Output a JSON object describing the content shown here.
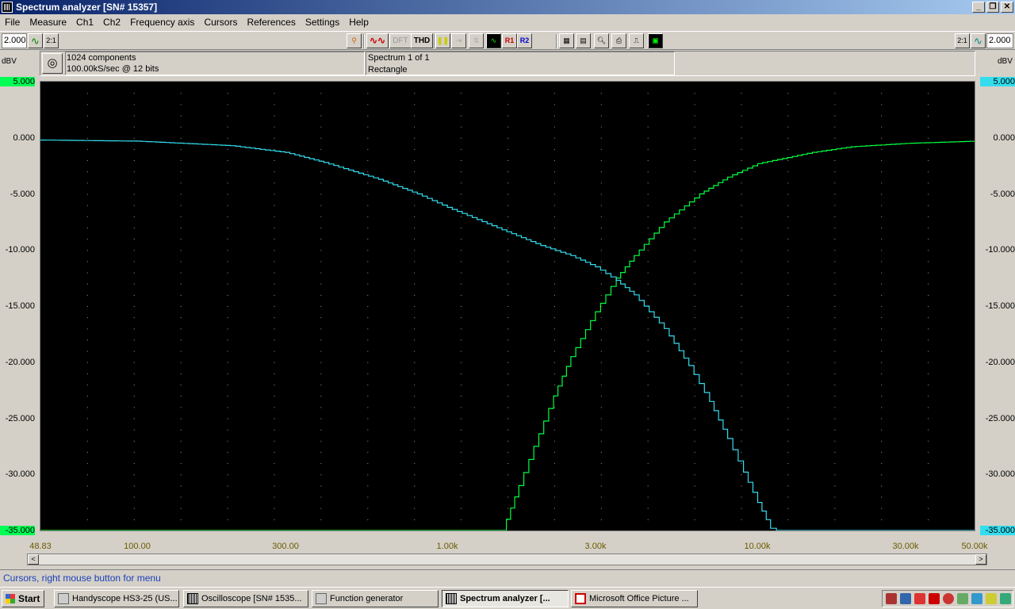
{
  "window": {
    "title": "Spectrum analyzer  [SN# 15357]",
    "controls": {
      "minimize": "_",
      "restore": "❐",
      "close": "✕"
    }
  },
  "menu": [
    "File",
    "Measure",
    "Ch1",
    "Ch2",
    "Frequency axis",
    "Cursors",
    "References",
    "Settings",
    "Help"
  ],
  "toolbar": {
    "left_scale": "2.000",
    "right_scale": "2.000",
    "ratio_label": "2:1",
    "dft_label": "DFT",
    "thd_label": "THD",
    "r1_label": "R1",
    "r2_label": "R2"
  },
  "info": {
    "components": "1024 components",
    "sample_rate": "100.00kS/sec @ 12 bits",
    "spectrum": "Spectrum 1 of 1",
    "window": "Rectangle"
  },
  "axis": {
    "y_unit_left": "dBV",
    "y_unit_right": "dBV",
    "y_ticks": [
      "5.000",
      "0.000",
      "-5.000",
      "-10.000",
      "-15.000",
      "-20.000",
      "-25.000",
      "-30.000",
      "-35.000"
    ],
    "x_ticks": [
      "48.83",
      "100.00",
      "300.00",
      "1.00k",
      "3.00k",
      "10.00k",
      "30.00k",
      "50.00k"
    ]
  },
  "chart_data": {
    "type": "line",
    "x_scale": "log",
    "xlim": [
      48.83,
      50000
    ],
    "ylim": [
      -35,
      5
    ],
    "grid": true,
    "series": [
      {
        "color": "#00ff40",
        "points": [
          [
            48.83,
            -35
          ],
          [
            1500,
            -35
          ],
          [
            1550,
            -34
          ],
          [
            1700,
            -31
          ],
          [
            1900,
            -27.5
          ],
          [
            2200,
            -23
          ],
          [
            2500,
            -19.5
          ],
          [
            3000,
            -15.5
          ],
          [
            3500,
            -12.5
          ],
          [
            4000,
            -10.5
          ],
          [
            5000,
            -7.5
          ],
          [
            6500,
            -5
          ],
          [
            8000,
            -3.5
          ],
          [
            10000,
            -2.3
          ],
          [
            15000,
            -1.3
          ],
          [
            20000,
            -0.8
          ],
          [
            30000,
            -0.5
          ],
          [
            50000,
            -0.3
          ]
        ]
      },
      {
        "color": "#33ddee",
        "points": [
          [
            48.83,
            -0.2
          ],
          [
            100,
            -0.3
          ],
          [
            200,
            -0.7
          ],
          [
            300,
            -1.3
          ],
          [
            400,
            -2.2
          ],
          [
            600,
            -3.7
          ],
          [
            800,
            -5
          ],
          [
            1000,
            -6.2
          ],
          [
            1500,
            -8.2
          ],
          [
            2000,
            -9.6
          ],
          [
            2500,
            -10.5
          ],
          [
            3000,
            -11.5
          ],
          [
            3500,
            -12.7
          ],
          [
            4000,
            -14
          ],
          [
            5000,
            -17
          ],
          [
            6000,
            -20.3
          ],
          [
            7000,
            -23.5
          ],
          [
            8000,
            -26.8
          ],
          [
            9000,
            -29.8
          ],
          [
            10000,
            -32.5
          ],
          [
            11000,
            -34.8
          ],
          [
            11500,
            -35
          ],
          [
            50000,
            -35
          ]
        ]
      }
    ]
  },
  "scrollbar": {
    "left": "<",
    "right": ">"
  },
  "status": "Cursors, right mouse button for menu",
  "taskbar": {
    "start": "Start",
    "tasks": [
      "Handyscope HS3-25 (US...",
      "Oscilloscope  [SN# 1535...",
      "Function generator",
      "Spectrum analyzer  [...",
      "Microsoft Office Picture ..."
    ]
  },
  "colors": {
    "ch1": "#00ff40",
    "ch2": "#33ddee",
    "grid": "#9a9a9a",
    "plot_bg": "#000000"
  }
}
